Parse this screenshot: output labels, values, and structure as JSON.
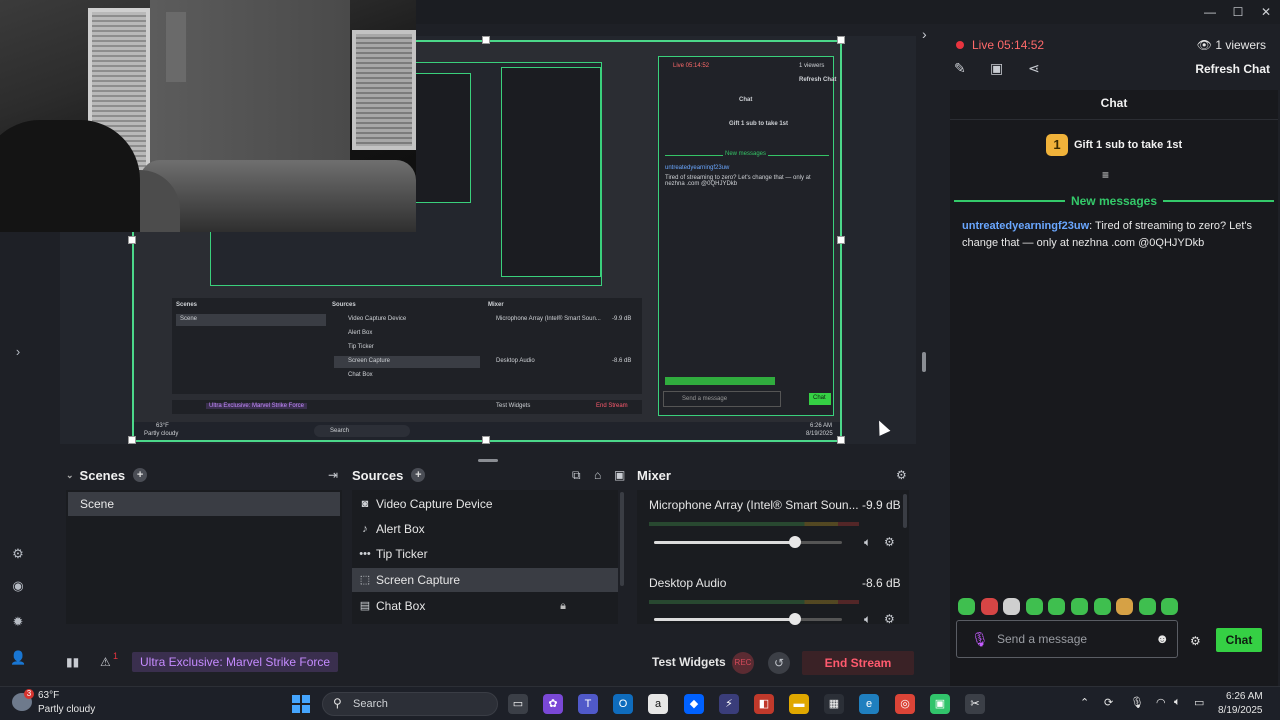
{
  "window": {
    "controls": {
      "minimize": "—",
      "maximize": "☐",
      "close": "✕"
    }
  },
  "preview": {
    "nested": {
      "live_text": "Live 05:14:52",
      "viewers": "1 viewers",
      "refresh": "Refresh Chat",
      "chat_title": "Chat",
      "gift": "Gift 1 sub to take 1st",
      "new_messages": "New messages",
      "message_user": "untreatedyearningf23uw",
      "message_text": "Tired of streaming to zero? Let's change that — only at nezhna .com @0QHJYDkb",
      "send_placeholder": "Send a message",
      "chat_button": "Chat",
      "scenes": "Scenes",
      "sources": "Sources",
      "mixer": "Mixer",
      "scene_item": "Scene",
      "source_items": [
        "Video Capture Device",
        "Alert Box",
        "Tip Ticker",
        "Screen Capture",
        "Chat Box"
      ],
      "mic_label": "Microphone Array (Intel® Smart Soun...",
      "mic_db": "-9.9 dB",
      "desktop_label": "Desktop Audio",
      "desktop_db": "-8.6 dB",
      "tag": "Ultra Exclusive: Marvel Strike Force",
      "test_widgets": "Test Widgets",
      "end_stream": "End Stream",
      "weather_temp": "63°F",
      "weather_desc": "Partly cloudy",
      "search": "Search",
      "time": "6:26 AM",
      "date": "8/19/2025"
    }
  },
  "scenes": {
    "title": "Scenes",
    "items": [
      "Scene"
    ]
  },
  "sources": {
    "title": "Sources",
    "items": [
      {
        "label": "Video Capture Device",
        "icon": "camera-icon"
      },
      {
        "label": "Alert Box",
        "icon": "bell-icon"
      },
      {
        "label": "Tip Ticker",
        "icon": "ellipsis-icon"
      },
      {
        "label": "Screen Capture",
        "icon": "screen-icon"
      },
      {
        "label": "Chat Box",
        "icon": "chat-icon"
      }
    ],
    "selected_index": 3
  },
  "mixer": {
    "title": "Mixer",
    "channels": [
      {
        "label": "Microphone Array (Intel® Smart Soun...",
        "db": "-9.9 dB",
        "volume": 0.75
      },
      {
        "label": "Desktop Audio",
        "db": "-8.6 dB",
        "volume": 0.75
      }
    ]
  },
  "bottom_bar": {
    "stream_title": "Ultra Exclusive: Marvel Strike Force",
    "alert_count": "1",
    "test_widgets": "Test Widgets",
    "rec_label": "REC",
    "end_stream": "End Stream"
  },
  "chat": {
    "live_text": "Live 05:14:52",
    "viewers": "1 viewers",
    "refresh": "Refresh Chat",
    "title": "Chat",
    "gift_rank": "1",
    "gift_text": "Gift 1 sub to take 1st",
    "new_messages": "New messages",
    "message": {
      "user": "untreatedyearningf23uw",
      "text": ": Tired of streaming to zero? Let's change that — only at nezhna .com @0QHJYDkb"
    },
    "input_placeholder": "Send a message",
    "send_button": "Chat",
    "emote_count": 10
  },
  "taskbar": {
    "weather_temp": "63°F",
    "weather_desc": "Partly cloudy",
    "weather_badge": "3",
    "search_text": "Search",
    "time": "6:26 AM",
    "date": "8/19/2025"
  },
  "colors": {
    "accent_green": "#35d044",
    "live_red": "#e8343f",
    "end_stream_red": "#ff5a6e",
    "user_blue": "#6aa7ff",
    "tag_purple": "#c58bff"
  }
}
